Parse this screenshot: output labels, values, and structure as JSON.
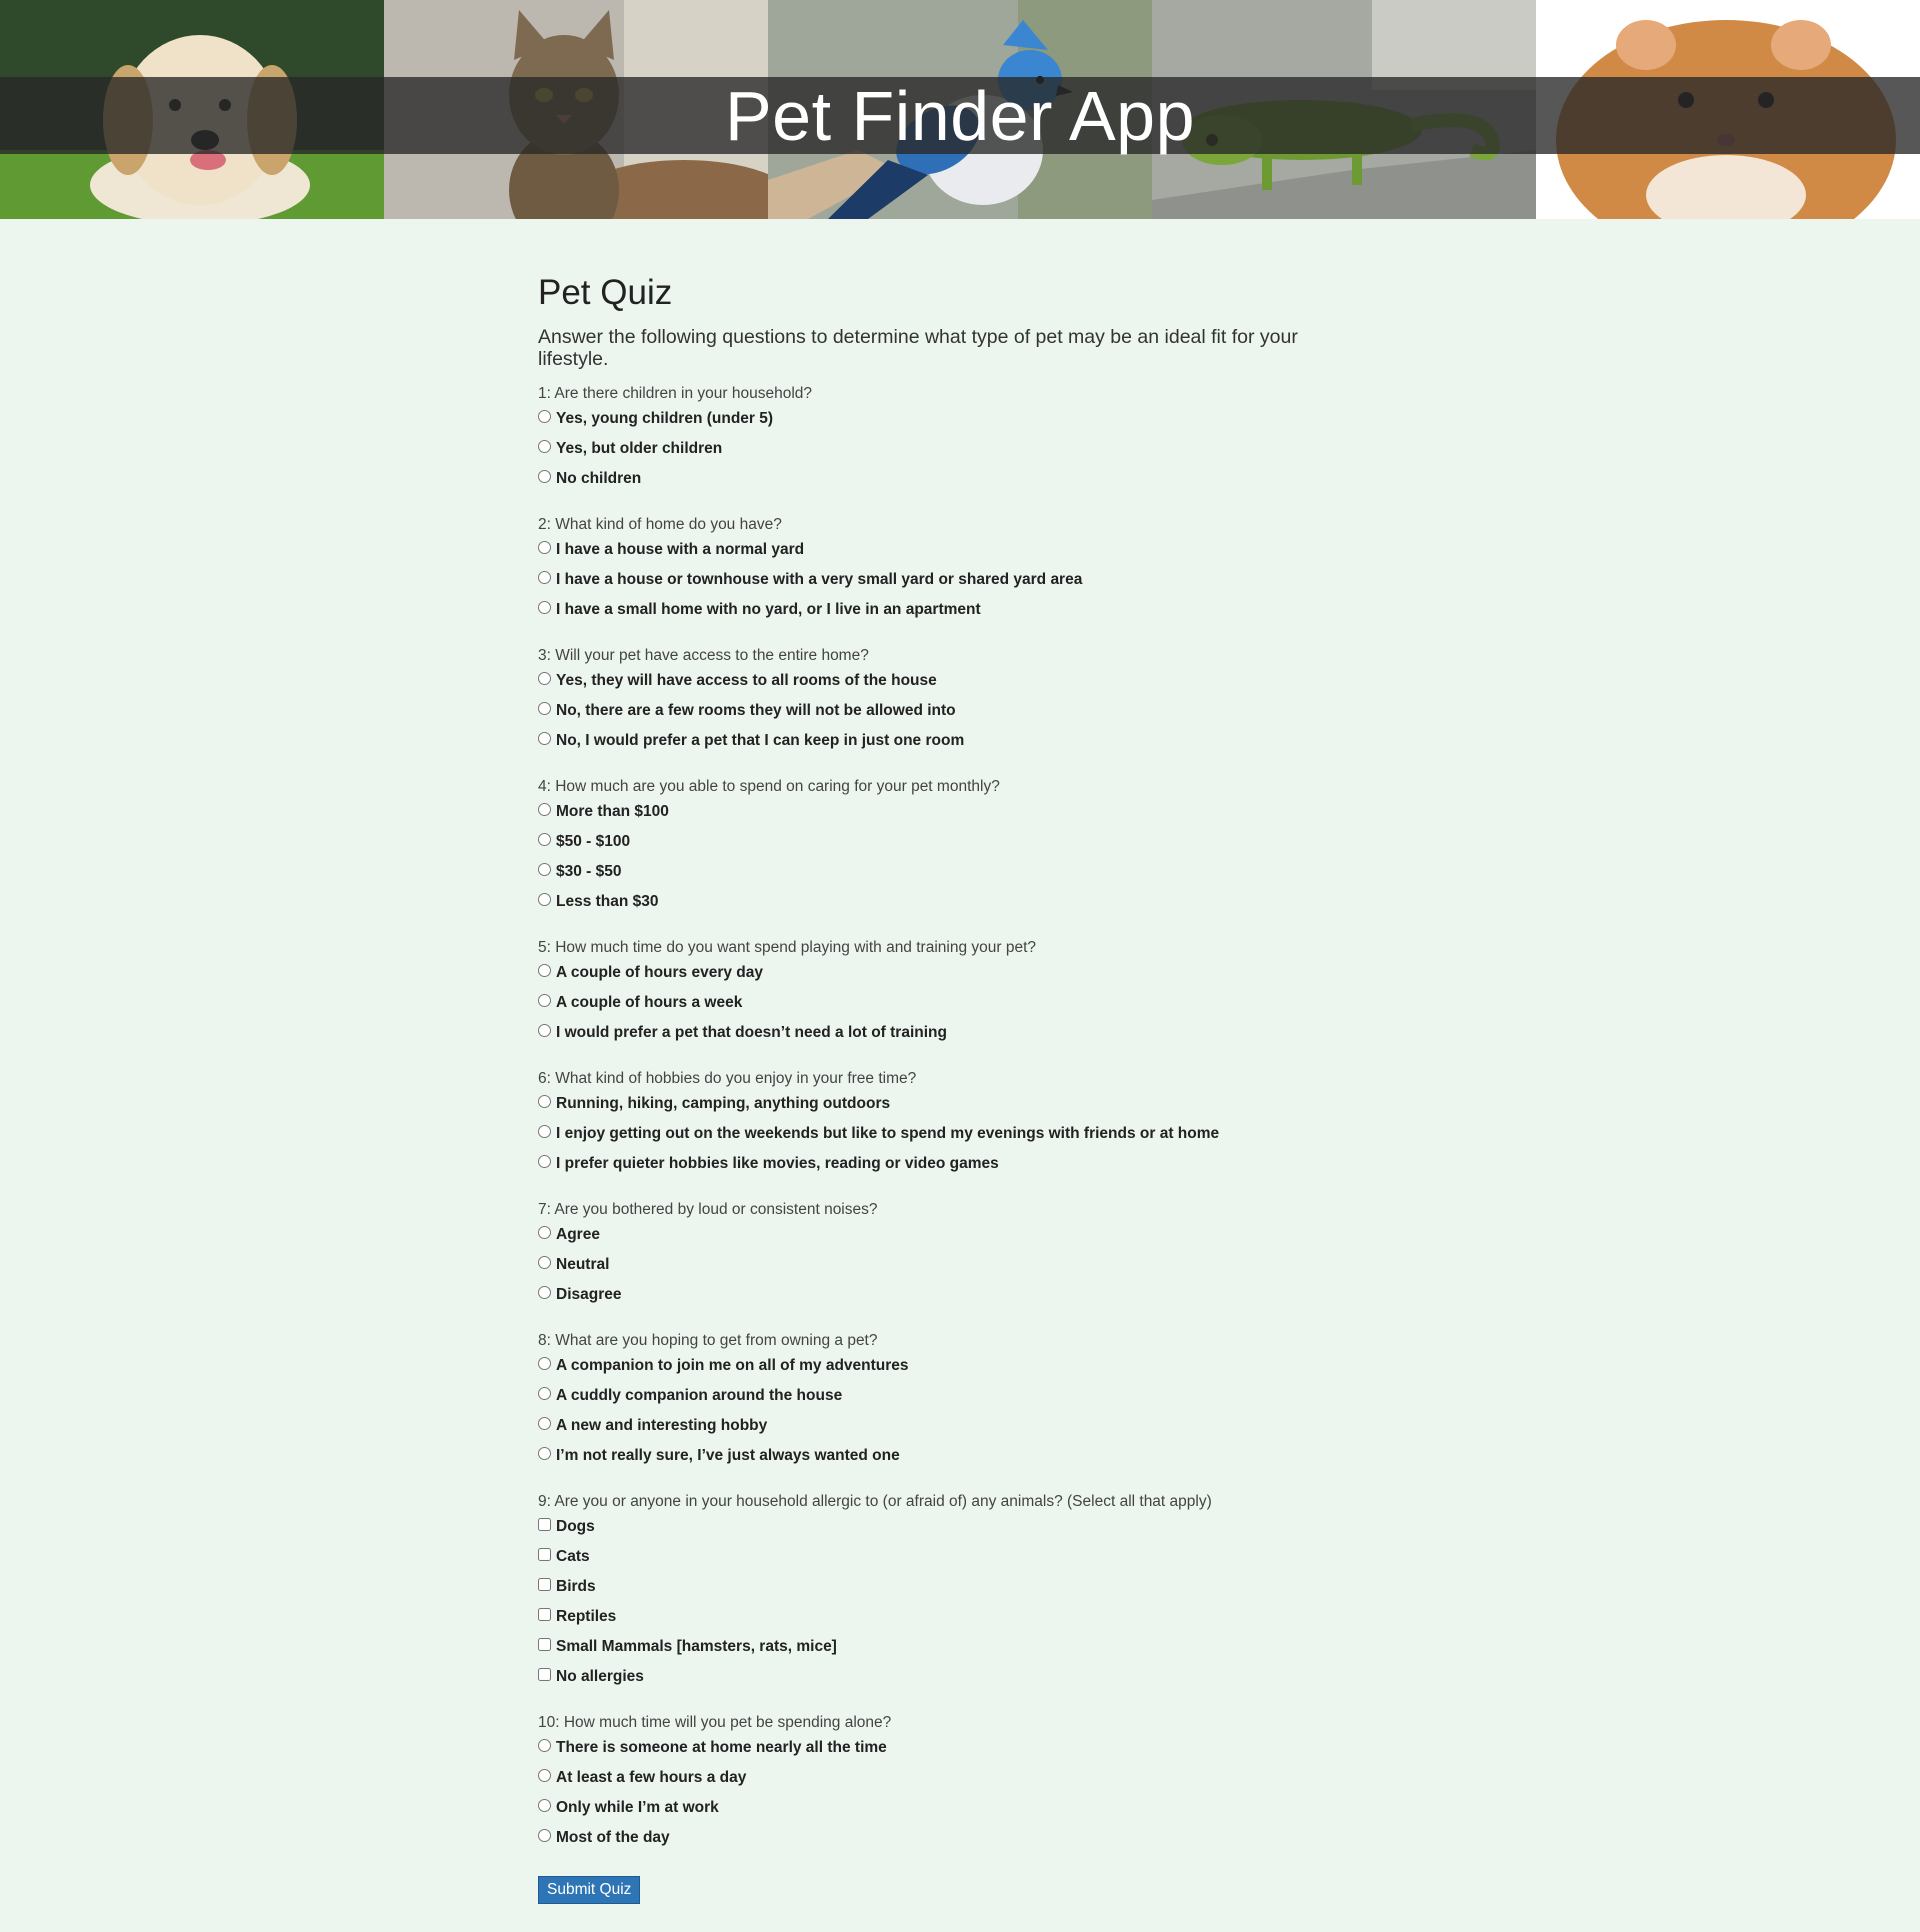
{
  "header": {
    "title": "Pet Finder App",
    "images": [
      "dog-photo",
      "cat-photo",
      "blue-jay-photo",
      "chameleon-photo",
      "hamster-photo"
    ]
  },
  "quiz": {
    "title": "Pet Quiz",
    "intro": "Answer the following questions to determine what type of pet may be an ideal fit for your lifestyle.",
    "submit_label": "Submit Quiz",
    "questions": [
      {
        "text": "1: Are there children in your household?",
        "type": "radio",
        "options": [
          "Yes, young children (under 5)",
          "Yes, but older children",
          "No children"
        ]
      },
      {
        "text": "2: What kind of home do you have?",
        "type": "radio",
        "options": [
          "I have a house with a normal yard",
          "I have a house or townhouse with a very small yard or shared yard area",
          "I have a small home with no yard, or I live in an apartment"
        ]
      },
      {
        "text": "3: Will your pet have access to the entire home?",
        "type": "radio",
        "options": [
          "Yes, they will have access to all rooms of the house",
          "No, there are a few rooms they will not be allowed into",
          "No, I would prefer a pet that I can keep in just one room"
        ]
      },
      {
        "text": "4: How much are you able to spend on caring for your pet monthly?",
        "type": "radio",
        "options": [
          "More than $100",
          "$50 - $100",
          "$30 - $50",
          "Less than $30"
        ]
      },
      {
        "text": "5: How much time do you want spend playing with and training your pet?",
        "type": "radio",
        "options": [
          "A couple of hours every day",
          "A couple of hours a week",
          "I would prefer a pet that doesn’t need a lot of training"
        ]
      },
      {
        "text": "6: What kind of hobbies do you enjoy in your free time?",
        "type": "radio",
        "options": [
          "Running, hiking, camping, anything outdoors",
          "I enjoy getting out on the weekends but like to spend my evenings with friends or at home",
          "I prefer quieter hobbies like movies, reading or video games"
        ]
      },
      {
        "text": "7: Are you bothered by loud or consistent noises?",
        "type": "radio",
        "options": [
          "Agree",
          "Neutral",
          "Disagree"
        ]
      },
      {
        "text": "8: What are you hoping to get from owning a pet?",
        "type": "radio",
        "options": [
          "A companion to join me on all of my adventures",
          "A cuddly companion around the house",
          "A new and interesting hobby",
          "I’m not really sure, I’ve just always wanted one"
        ]
      },
      {
        "text": "9: Are you or anyone in your household allergic to (or afraid of) any animals? (Select all that apply)",
        "type": "checkbox",
        "options": [
          "Dogs",
          "Cats",
          "Birds",
          "Reptiles",
          "Small Mammals [hamsters, rats, mice]",
          "No allergies"
        ]
      },
      {
        "text": "10: How much time will you pet be spending alone?",
        "type": "radio",
        "options": [
          "There is someone at home nearly all the time",
          "At least a few hours a day",
          "Only while I’m at work",
          "Most of the day"
        ]
      }
    ]
  }
}
